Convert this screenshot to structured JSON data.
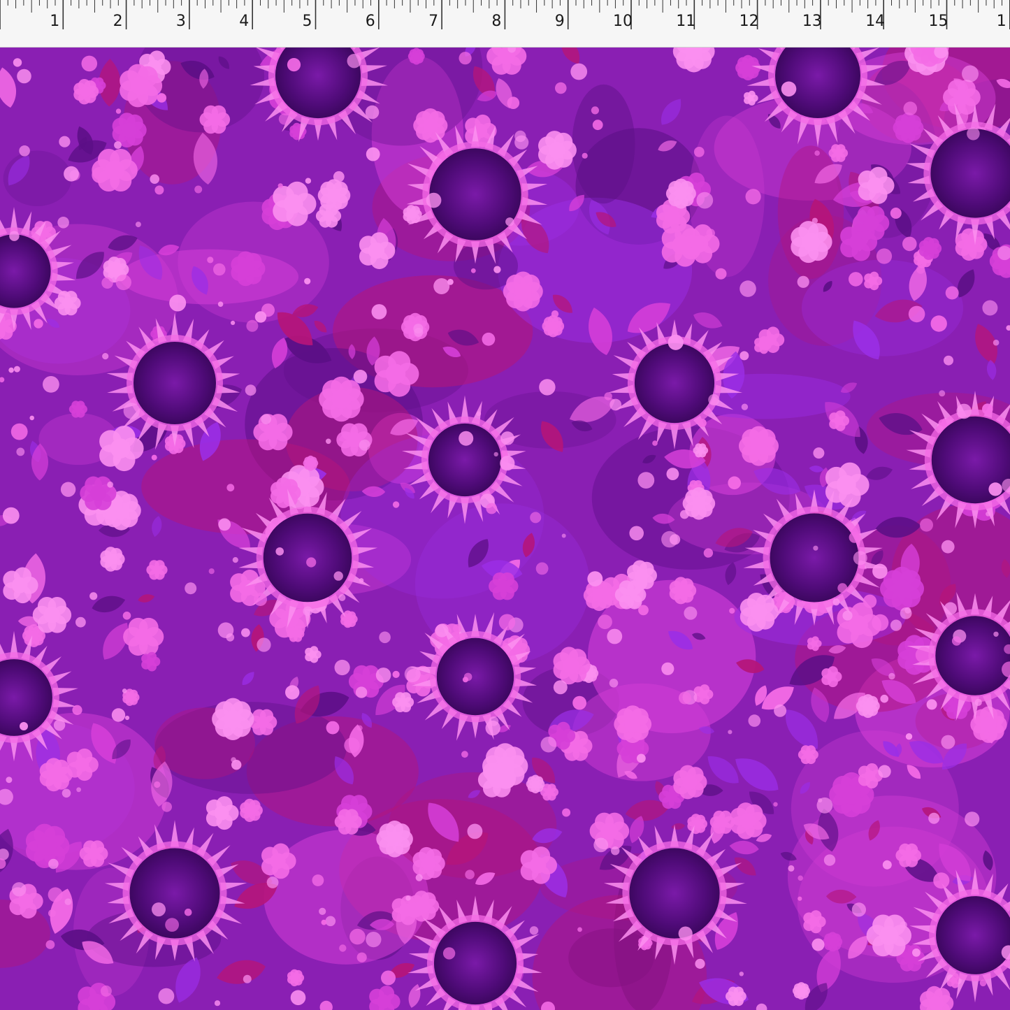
{
  "ruler": {
    "unit_labels": [
      "1",
      "2",
      "3",
      "4",
      "5",
      "6",
      "7",
      "8",
      "9",
      "10",
      "11",
      "12",
      "13",
      "14",
      "15",
      "1"
    ]
  },
  "fabric": {
    "pattern": "tossed floral silhouettes",
    "palette": {
      "base": "#8a1fb3",
      "deep": "#5c0f86",
      "violet": "#9b2ee6",
      "magenta": "#d63fd8",
      "pink": "#f46be6",
      "light_pink": "#fb8ff0",
      "crimson": "#b5157a"
    }
  }
}
